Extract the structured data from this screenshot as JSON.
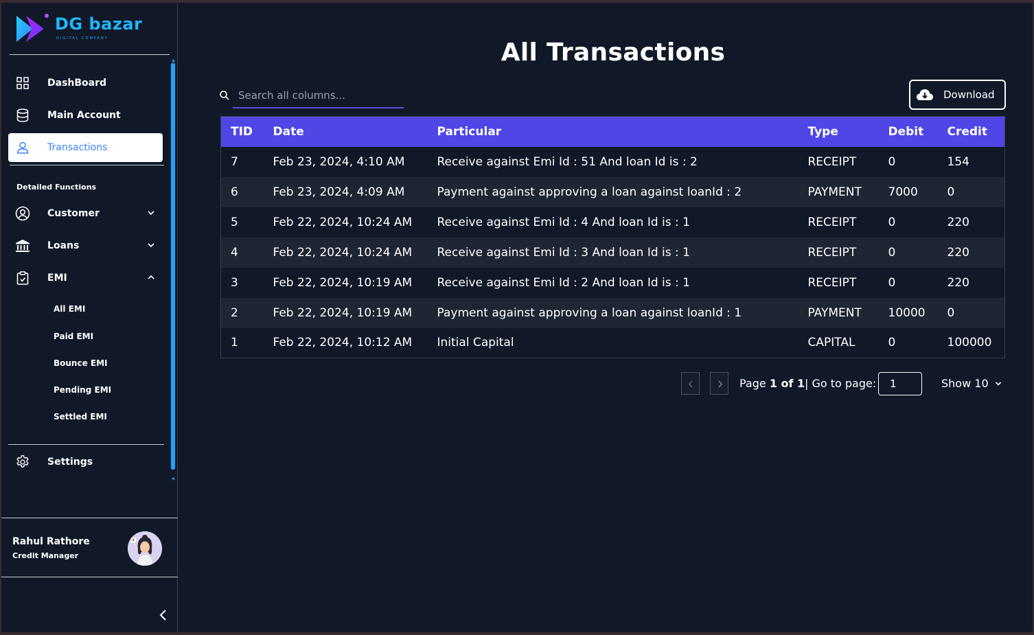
{
  "brand": {
    "name": "DG bazar",
    "tagline": "DIGITAL COMPANY"
  },
  "sidebar": {
    "items": [
      {
        "label": "DashBoard",
        "icon": "grid-icon"
      },
      {
        "label": "Main Account",
        "icon": "database-icon"
      },
      {
        "label": "Transactions",
        "icon": "user-icon",
        "active": true
      }
    ],
    "section_title": "Detailed Functions",
    "groups": [
      {
        "label": "Customer",
        "icon": "user-circle-icon",
        "expanded": false
      },
      {
        "label": "Loans",
        "icon": "bank-icon",
        "expanded": false
      },
      {
        "label": "EMI",
        "icon": "clipboard-icon",
        "expanded": true
      }
    ],
    "emi_sub": [
      "All EMI",
      "Paid EMI",
      "Bounce EMI",
      "Pending EMI",
      "Settled EMI"
    ],
    "settings": "Settings"
  },
  "profile": {
    "name": "Rahul Rathore",
    "role": "Credit Manager"
  },
  "main": {
    "title": "All Transactions",
    "search_placeholder": "Search all columns...",
    "download_label": "Download"
  },
  "table": {
    "headers": [
      "TID",
      "Date",
      "Particular",
      "Type",
      "Debit",
      "Credit"
    ],
    "rows": [
      [
        "7",
        "Feb 23, 2024, 4:10 AM",
        "Receive against Emi Id : 51 And loan Id is : 2",
        "RECEIPT",
        "0",
        "154"
      ],
      [
        "6",
        "Feb 23, 2024, 4:09 AM",
        "Payment against approving a loan against loanId : 2",
        "PAYMENT",
        "7000",
        "0"
      ],
      [
        "5",
        "Feb 22, 2024, 10:24 AM",
        "Receive against Emi Id : 4 And loan Id is : 1",
        "RECEIPT",
        "0",
        "220"
      ],
      [
        "4",
        "Feb 22, 2024, 10:24 AM",
        "Receive against Emi Id : 3 And loan Id is : 1",
        "RECEIPT",
        "0",
        "220"
      ],
      [
        "3",
        "Feb 22, 2024, 10:19 AM",
        "Receive against Emi Id : 2 And loan Id is : 1",
        "RECEIPT",
        "0",
        "220"
      ],
      [
        "2",
        "Feb 22, 2024, 10:19 AM",
        "Payment against approving a loan against loanId : 1",
        "PAYMENT",
        "10000",
        "0"
      ],
      [
        "1",
        "Feb 22, 2024, 10:12 AM",
        "Initial Capital",
        "CAPITAL",
        "0",
        "100000"
      ]
    ]
  },
  "pagination": {
    "page_word": "Page",
    "page_of": "1 of 1",
    "goto_label": "| Go to page:",
    "goto_value": "1",
    "show_label": "Show 10"
  },
  "colors": {
    "background": "#111827",
    "header": "#4f46e5",
    "accent": "#1fa2ff",
    "active_text": "#3b82f6"
  }
}
